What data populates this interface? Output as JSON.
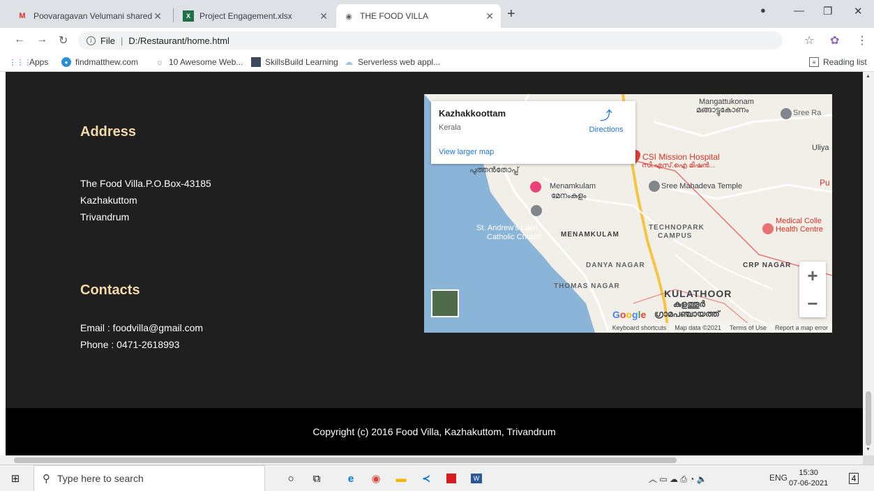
{
  "browser": {
    "tabs": [
      {
        "title": "Poovaragavan Velumani shared",
        "favicon": "gmail-icon",
        "active": false
      },
      {
        "title": "Project Engagement.xlsx",
        "favicon": "excel-icon",
        "active": false
      },
      {
        "title": "THE FOOD VILLA",
        "favicon": "globe-icon",
        "active": true
      }
    ],
    "new_tab": "+",
    "address": {
      "scheme": "File",
      "path": "D:/Restaurant/home.html"
    },
    "bookmarks": [
      "Apps",
      "findmatthew.com",
      "10 Awesome Web...",
      "SkillsBuild Learning",
      "Serverless web appl..."
    ],
    "reading_list": "Reading list"
  },
  "page": {
    "address_heading": "Address",
    "address_lines": [
      "The Food Villa.P.O.Box-43185",
      "Kazhakuttom",
      "Trivandrum"
    ],
    "contacts_heading": "Contacts",
    "email": "Email : foodvilla@gmail.com",
    "phone": "Phone : 0471-2618993",
    "footer": "Copyright (c) 2016 Food Villa, Kazhakuttom, Trivandrum",
    "heading_color": "#f3d8a8",
    "background": "#1f1f1f"
  },
  "map": {
    "place": "Kazhakkoottam",
    "region": "Kerala",
    "directions": "Directions",
    "view_larger": "View larger map",
    "labels": {
      "mangattukonam": "Mangattukonam",
      "mangattukonam_ml": "മങ്ങാട്ടുകോണം",
      "csi": "CSI Mission Hospital",
      "csi_ml": "സി.എസ്.ഐ മിഷൻ...",
      "sree_mahadeva": "Sree Mahadeva Temple",
      "menamkulam": "Menamkulam",
      "menamkulam_ml": "മേനംകുളം",
      "st_andrews": "St. Andrew's Latin",
      "catholic": "Catholic Church",
      "technopark": "TECHNOPARK",
      "campus": "CAMPUS",
      "menamkulam_caps": "MENAMKULAM",
      "medical": "Medical Colle",
      "health": "Health Centre",
      "crp": "CRP NAGAR",
      "danya": "DANYA NAGAR",
      "thomas": "THOMAS NAGAR",
      "kulathoor": "KULATHOOR",
      "kulathoor_ml": "കുളത്തൂർ",
      "grama": "ഗ്രാമപഞ്ചായത്ത്",
      "sree_ram": "Sree Ra",
      "uliya": "Uliya",
      "pu": "Pu",
      "puthen": "പുത്തൻതോപ്പ്"
    },
    "zoom_in": "+",
    "zoom_out": "−",
    "google": "Google",
    "attribution": [
      "Keyboard shortcuts",
      "Map data ©2021",
      "Terms of Use",
      "Report a map error"
    ]
  },
  "taskbar": {
    "search_placeholder": "Type here to search",
    "language": "ENG",
    "time": "15:30",
    "date": "07-06-2021",
    "notifications": "4"
  }
}
